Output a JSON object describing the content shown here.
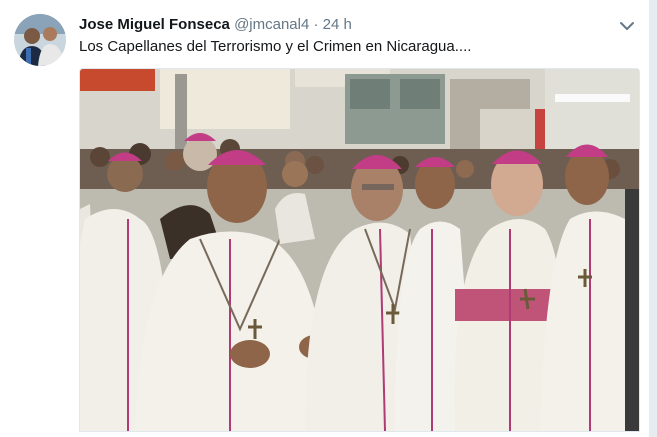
{
  "tweet": {
    "author_name": "Jose Miguel Fonseca",
    "handle": "@jmcanal4",
    "separator": "·",
    "time": "24 h",
    "text": "Los Capellanes del Terrorismo y el Crimen en Nicaragua...."
  },
  "icons": {
    "caret": "chevron-down-icon"
  },
  "colors": {
    "name": "#14171a",
    "meta": "#657786",
    "cassock": "#f1efe8",
    "piping": "#b03a73",
    "zucchetto": "#c23c86"
  }
}
